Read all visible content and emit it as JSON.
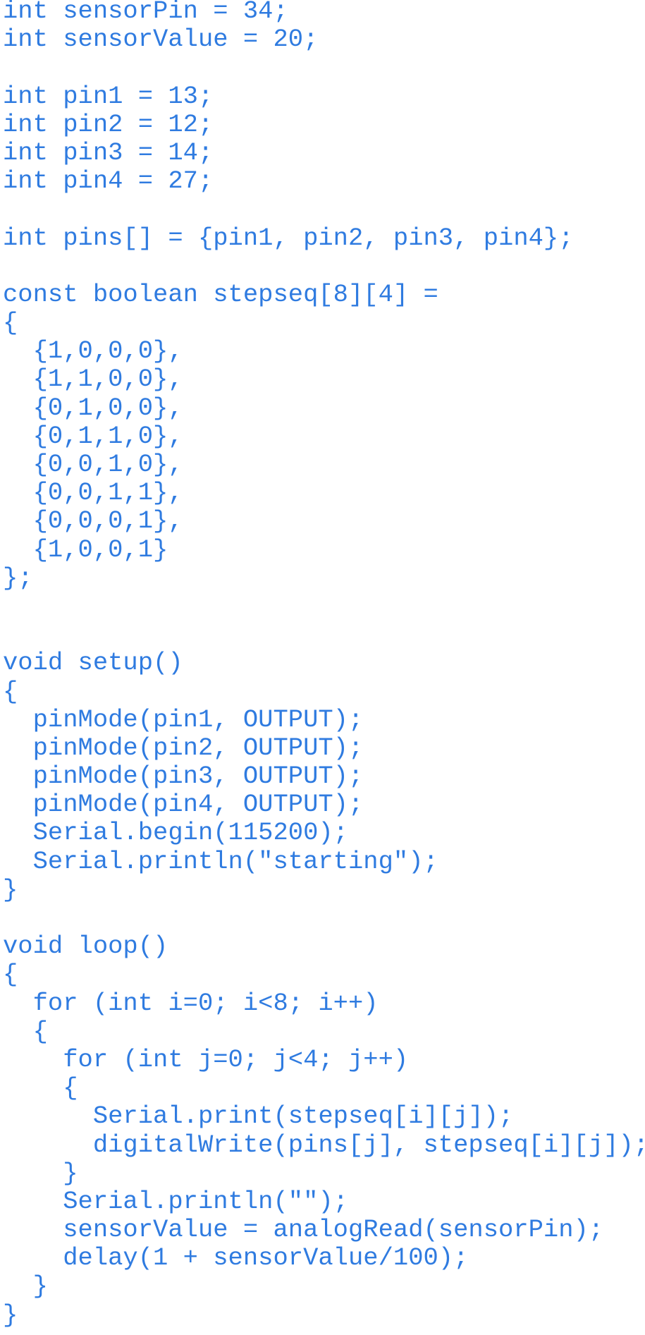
{
  "document": {
    "language": "Arduino C++",
    "text_color": "#2f7be0",
    "background_color": "#ffffff",
    "lines": [
      "int sensorPin = 34;",
      "int sensorValue = 20;",
      "",
      "int pin1 = 13;",
      "int pin2 = 12;",
      "int pin3 = 14;",
      "int pin4 = 27;",
      "",
      "int pins[] = {pin1, pin2, pin3, pin4};",
      "",
      "const boolean stepseq[8][4] =",
      "{",
      "  {1,0,0,0},",
      "  {1,1,0,0},",
      "  {0,1,0,0},",
      "  {0,1,1,0},",
      "  {0,0,1,0},",
      "  {0,0,1,1},",
      "  {0,0,0,1},",
      "  {1,0,0,1}",
      "};",
      "",
      "",
      "void setup()",
      "{",
      "  pinMode(pin1, OUTPUT);",
      "  pinMode(pin2, OUTPUT);",
      "  pinMode(pin3, OUTPUT);",
      "  pinMode(pin4, OUTPUT);",
      "  Serial.begin(115200);",
      "  Serial.println(\"starting\");",
      "}",
      "",
      "void loop()",
      "{",
      "  for (int i=0; i<8; i++)",
      "  {",
      "    for (int j=0; j<4; j++)",
      "    {",
      "      Serial.print(stepseq[i][j]);",
      "      digitalWrite(pins[j], stepseq[i][j]);",
      "    }",
      "    Serial.println(\"\");",
      "    sensorValue = analogRead(sensorPin);",
      "    delay(1 + sensorValue/100);",
      "  }",
      "}"
    ]
  }
}
